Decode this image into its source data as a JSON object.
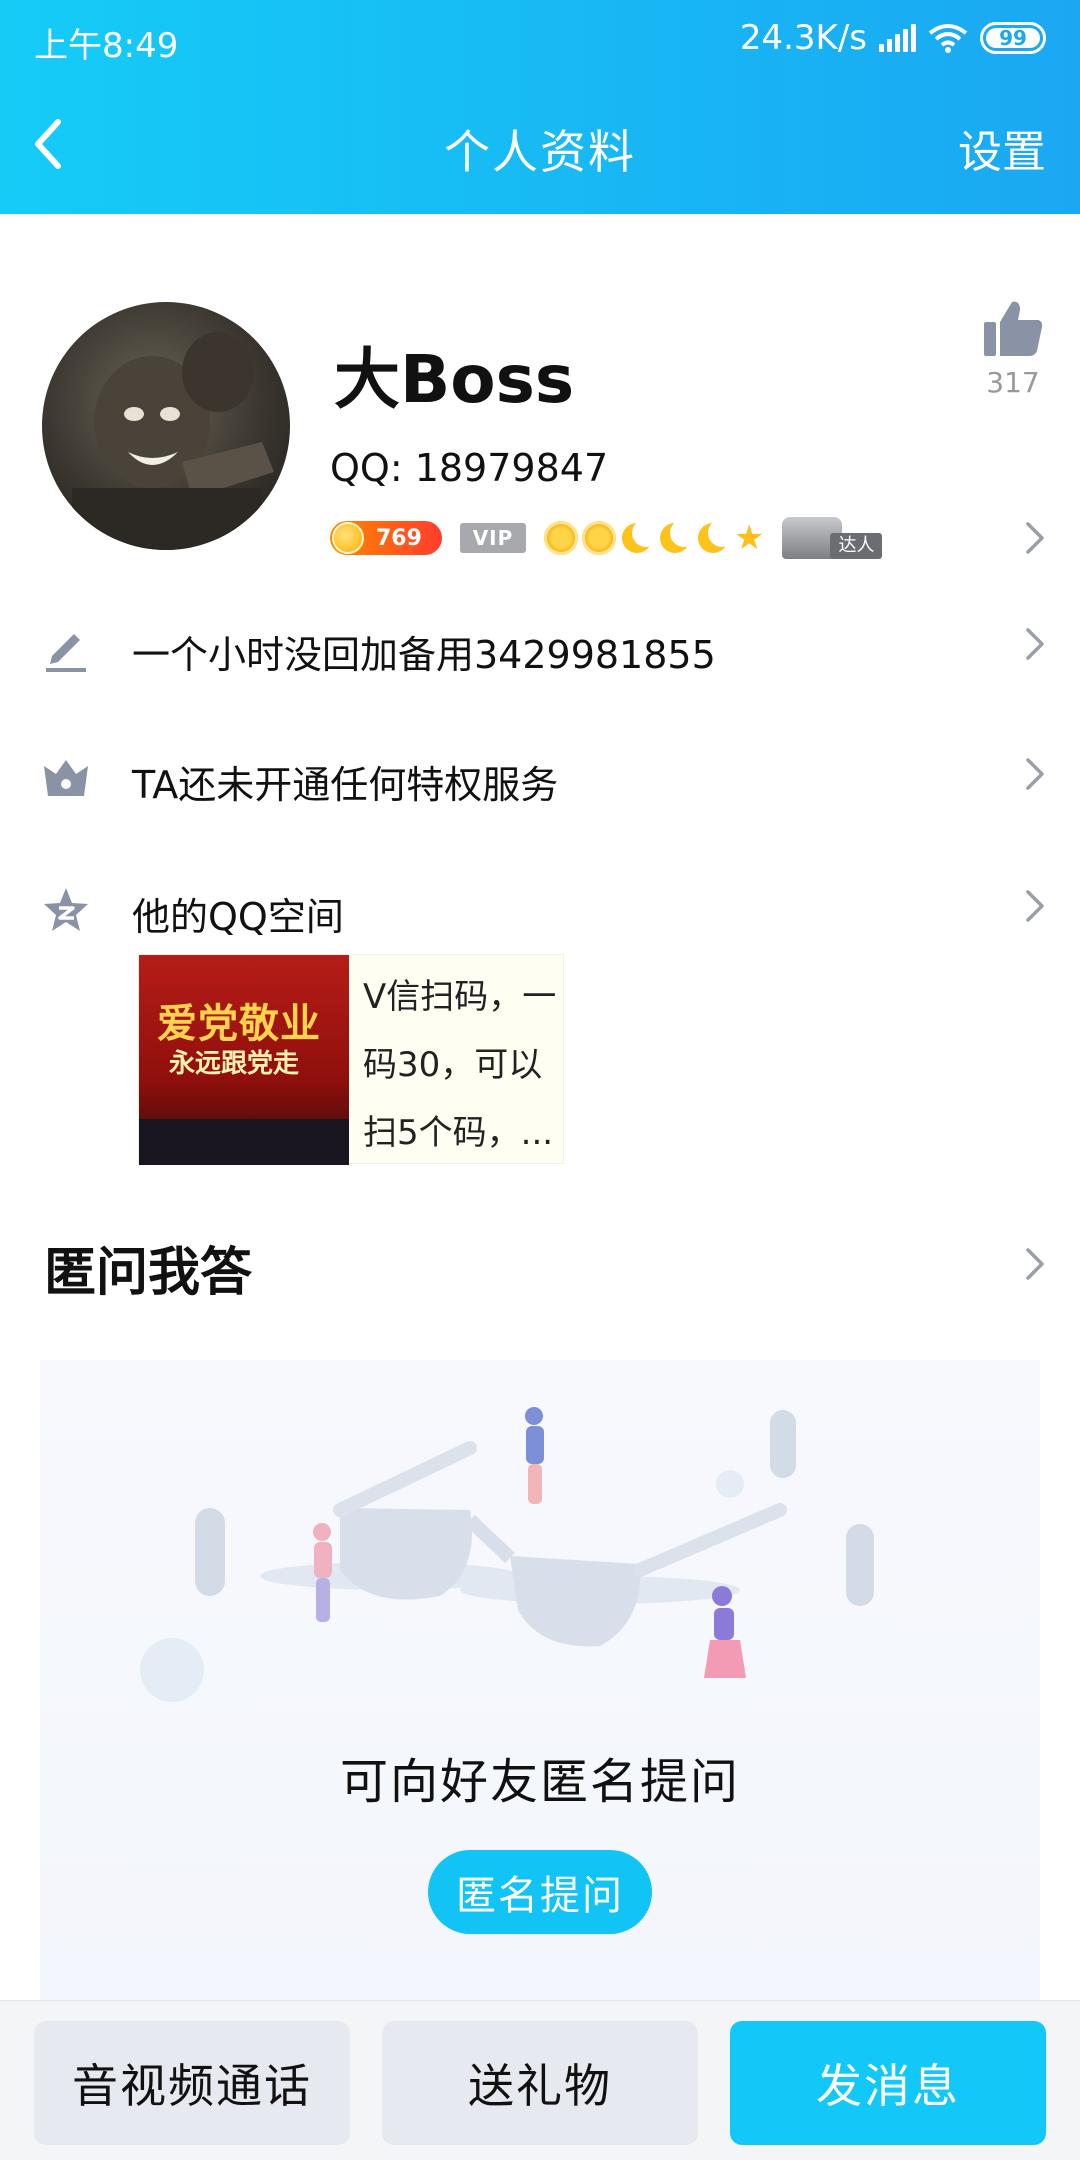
{
  "status_bar": {
    "time": "上午8:49",
    "network_speed": "24.3K/s",
    "battery": "99"
  },
  "nav": {
    "title": "个人资料",
    "settings_label": "设置"
  },
  "profile": {
    "nickname": "大Boss",
    "qq_label": "QQ: 18979847",
    "like_count": "317",
    "coin_level": "769",
    "vip_label": "VIP",
    "talent_label": "达人"
  },
  "rows": {
    "signature": "一个小时没回加备用3429981855",
    "privilege": "TA还未开通任何特权服务",
    "qzone": "他的QQ空间"
  },
  "qzone_card": {
    "thumb_line1": "爱党敬业",
    "thumb_line2": "永远跟党走",
    "text_lines": [
      "V信扫码，一",
      "码30，可以",
      "扫5个码，..."
    ]
  },
  "qa": {
    "section_title": "匿问我答",
    "caption": "可向好友匿名提问",
    "button_label": "匿名提问"
  },
  "bottom_bar": {
    "call_label": "音视频通话",
    "gift_label": "送礼物",
    "message_label": "发消息"
  },
  "colors": {
    "header_start": "#15ccf7",
    "header_end": "#1aa8f2",
    "accent": "#12c8f8",
    "secondary_button": "#e7e9f1"
  },
  "icons": {
    "back": "chevron-left-icon",
    "like": "thumbs-up-icon",
    "signature": "pencil-icon",
    "privilege": "crown-icon",
    "qzone": "qzone-star-icon",
    "row_arrow": "chevron-right-icon"
  }
}
